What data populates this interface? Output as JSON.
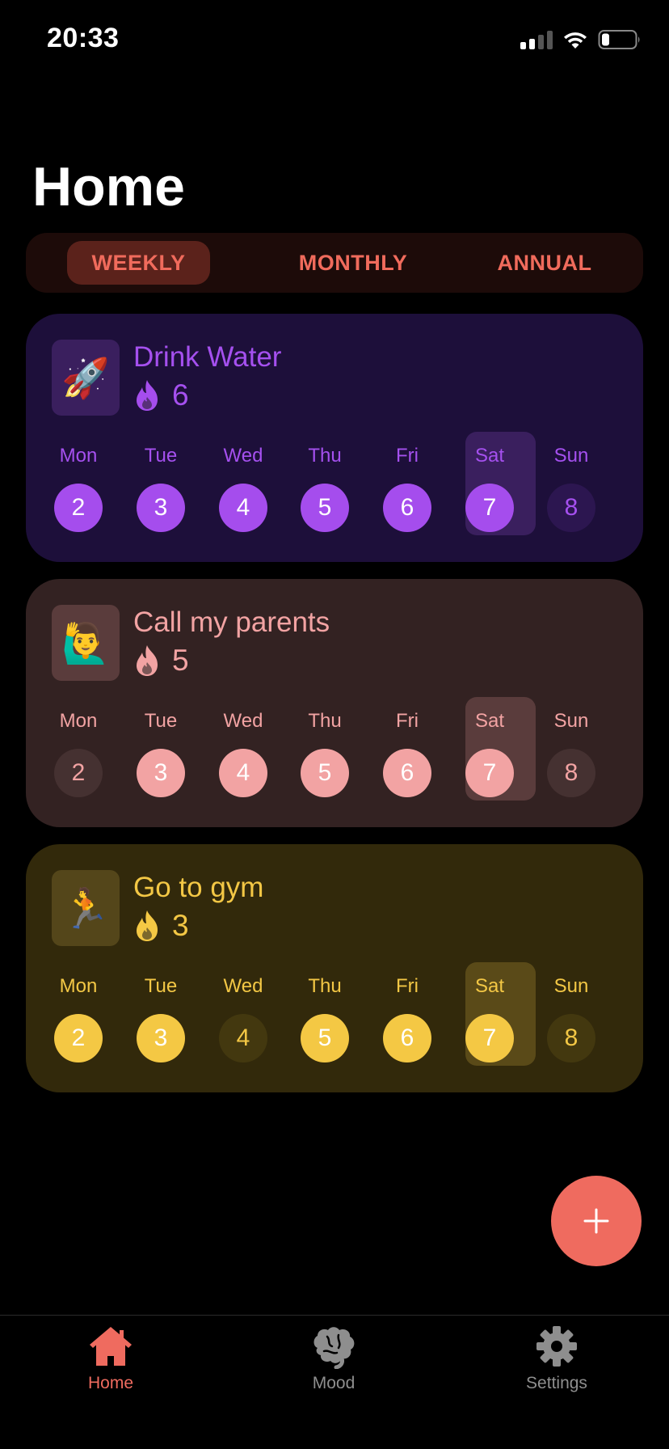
{
  "status_bar": {
    "time": "20:33"
  },
  "page": {
    "title": "Home"
  },
  "segmented": {
    "weekly": "WEEKLY",
    "monthly": "MONTHLY",
    "annual": "ANNUAL",
    "selected": "WEEKLY"
  },
  "habits": [
    {
      "title": "Drink Water",
      "icon": "rocket-emoji",
      "icon_glyph": "🚀",
      "streak": "6",
      "accent": "#a54ded",
      "days": [
        {
          "label": "Mon",
          "date": "2",
          "done": true
        },
        {
          "label": "Tue",
          "date": "3",
          "done": true
        },
        {
          "label": "Wed",
          "date": "4",
          "done": true
        },
        {
          "label": "Thu",
          "date": "5",
          "done": true
        },
        {
          "label": "Fri",
          "date": "6",
          "done": true
        },
        {
          "label": "Sat",
          "date": "7",
          "done": true,
          "today": true
        },
        {
          "label": "Sun",
          "date": "8",
          "done": false
        }
      ]
    },
    {
      "title": "Call my parents",
      "icon": "person-raising-hand-emoji",
      "icon_glyph": "🙋‍♂️",
      "streak": "5",
      "accent": "#f2a3a3",
      "days": [
        {
          "label": "Mon",
          "date": "2",
          "done": false
        },
        {
          "label": "Tue",
          "date": "3",
          "done": true
        },
        {
          "label": "Wed",
          "date": "4",
          "done": true
        },
        {
          "label": "Thu",
          "date": "5",
          "done": true
        },
        {
          "label": "Fri",
          "date": "6",
          "done": true
        },
        {
          "label": "Sat",
          "date": "7",
          "done": true,
          "today": true
        },
        {
          "label": "Sun",
          "date": "8",
          "done": false
        }
      ]
    },
    {
      "title": "Go to gym",
      "icon": "person-running-emoji",
      "icon_glyph": "🏃",
      "streak": "3",
      "accent": "#f4c844",
      "days": [
        {
          "label": "Mon",
          "date": "2",
          "done": true
        },
        {
          "label": "Tue",
          "date": "3",
          "done": true
        },
        {
          "label": "Wed",
          "date": "4",
          "done": false
        },
        {
          "label": "Thu",
          "date": "5",
          "done": true
        },
        {
          "label": "Fri",
          "date": "6",
          "done": true
        },
        {
          "label": "Sat",
          "date": "7",
          "done": true,
          "today": true
        },
        {
          "label": "Sun",
          "date": "8",
          "done": false
        }
      ]
    }
  ],
  "fab": {
    "icon": "plus-icon"
  },
  "tab_bar": {
    "tabs": [
      {
        "label": "Home",
        "icon": "home-icon",
        "active": true
      },
      {
        "label": "Mood",
        "icon": "brain-icon",
        "active": false
      },
      {
        "label": "Settings",
        "icon": "gear-icon",
        "active": false
      }
    ]
  },
  "colors": {
    "accent": "#ef6b5f",
    "background": "#000000"
  }
}
